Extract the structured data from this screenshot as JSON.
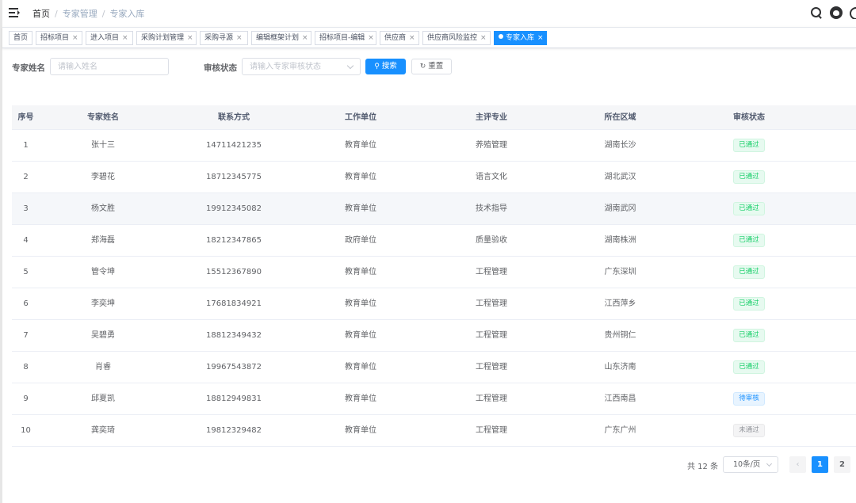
{
  "header": {
    "breadcrumb": [
      "首页",
      "专家管理",
      "专家入库"
    ],
    "separator": "/"
  },
  "tags": [
    {
      "label": "首页",
      "closable": false,
      "active": false
    },
    {
      "label": "招标项目",
      "closable": true,
      "active": false
    },
    {
      "label": "进入项目",
      "closable": true,
      "active": false
    },
    {
      "label": "采购计划管理",
      "closable": true,
      "active": false
    },
    {
      "label": "采购寻源",
      "closable": true,
      "active": false
    },
    {
      "label": "编辑框架计划",
      "closable": true,
      "active": false
    },
    {
      "label": "招标项目-编辑",
      "closable": true,
      "active": false
    },
    {
      "label": "供应商",
      "closable": true,
      "active": false
    },
    {
      "label": "供应商风险监控",
      "closable": true,
      "active": false
    },
    {
      "label": "专家入库",
      "closable": true,
      "active": true
    }
  ],
  "tag_close_glyph": "×",
  "search": {
    "name_label": "专家姓名",
    "name_placeholder": "请输入姓名",
    "status_label": "审核状态",
    "status_placeholder": "请输入专家审核状态",
    "search_btn": "搜索",
    "reset_btn": "重置"
  },
  "table": {
    "columns": [
      "序号",
      "专家姓名",
      "联系方式",
      "工作单位",
      "主评专业",
      "所在区域",
      "审核状态"
    ],
    "rows": [
      {
        "no": "1",
        "name": "张十三",
        "phone": "14711421235",
        "unit": "教育单位",
        "major": "养殖管理",
        "region": "湖南长沙",
        "status": "已通过",
        "status_type": "success"
      },
      {
        "no": "2",
        "name": "李碧花",
        "phone": "18712345775",
        "unit": "教育单位",
        "major": "语言文化",
        "region": "湖北武汉",
        "status": "已通过",
        "status_type": "success"
      },
      {
        "no": "3",
        "name": "杨文胜",
        "phone": "19912345082",
        "unit": "教育单位",
        "major": "技术指导",
        "region": "湖南武冈",
        "status": "已通过",
        "status_type": "success"
      },
      {
        "no": "4",
        "name": "郑海磊",
        "phone": "18212347865",
        "unit": "政府单位",
        "major": "质量验收",
        "region": "湖南株洲",
        "status": "已通过",
        "status_type": "success"
      },
      {
        "no": "5",
        "name": "管令坤",
        "phone": "15512367890",
        "unit": "教育单位",
        "major": "工程管理",
        "region": "广东深圳",
        "status": "已通过",
        "status_type": "success"
      },
      {
        "no": "6",
        "name": "李奕坤",
        "phone": "17681834921",
        "unit": "教育单位",
        "major": "工程管理",
        "region": "江西萍乡",
        "status": "已通过",
        "status_type": "success"
      },
      {
        "no": "7",
        "name": "吴碧勇",
        "phone": "18812349432",
        "unit": "教育单位",
        "major": "工程管理",
        "region": "贵州铜仁",
        "status": "已通过",
        "status_type": "success"
      },
      {
        "no": "8",
        "name": "肖睿",
        "phone": "19967543872",
        "unit": "教育单位",
        "major": "工程管理",
        "region": "山东济南",
        "status": "已通过",
        "status_type": "success"
      },
      {
        "no": "9",
        "name": "邱夏凯",
        "phone": "18812949831",
        "unit": "教育单位",
        "major": "工程管理",
        "region": "江西南昌",
        "status": "待审核",
        "status_type": "info"
      },
      {
        "no": "10",
        "name": "龚奕琦",
        "phone": "19812329482",
        "unit": "教育单位",
        "major": "工程管理",
        "region": "广东广州",
        "status": "未通过",
        "status_type": "neutral"
      }
    ]
  },
  "status_colors": {
    "success": {
      "fg": "#13ce66",
      "bg": "#e7faf0",
      "border": "#d0f5e0"
    },
    "info": {
      "fg": "#1890ff",
      "bg": "#e8f4ff",
      "border": "#d1e9ff"
    },
    "neutral": {
      "fg": "#909399",
      "bg": "#f4f4f5",
      "border": "#e9e9eb"
    }
  },
  "pagination": {
    "total_text": "共 12 条",
    "page_size": "10条/页",
    "prev_glyph": "‹",
    "pages": [
      "1",
      "2"
    ],
    "current": "1"
  },
  "colors": {
    "primary": "#1890ff"
  }
}
